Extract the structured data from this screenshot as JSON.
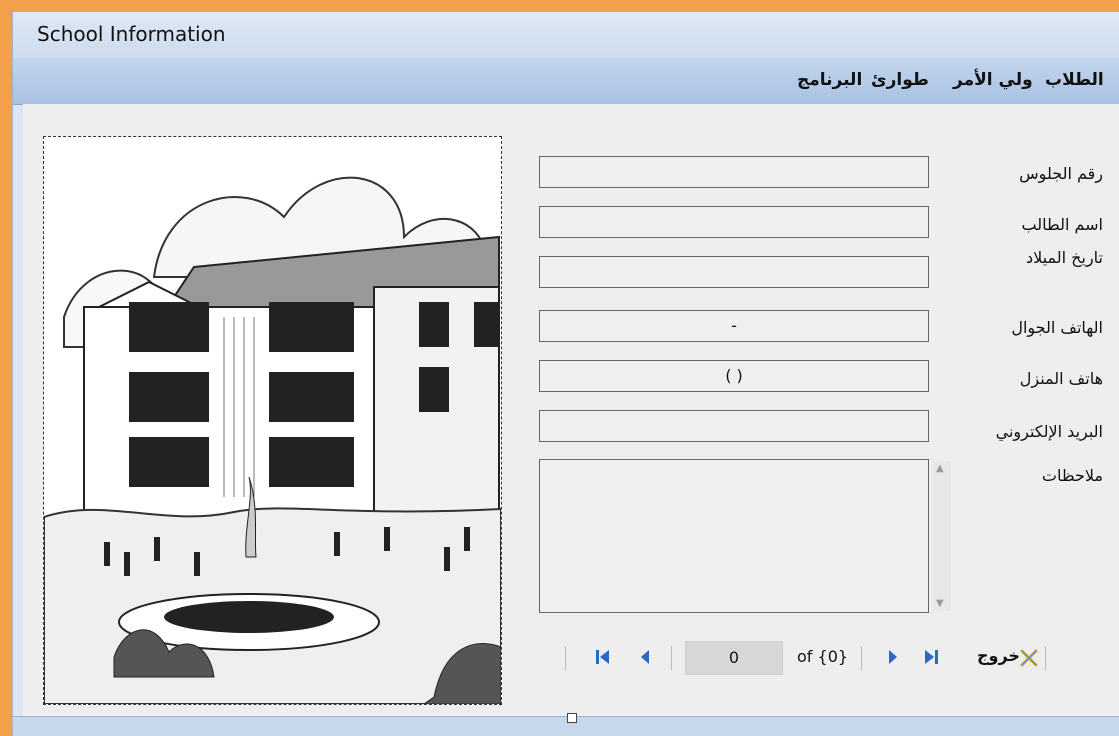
{
  "window": {
    "title": "School Information"
  },
  "menu": {
    "items": [
      {
        "label": "الطلاب"
      },
      {
        "label": "ولي الأمر"
      },
      {
        "label": "طوارئ"
      },
      {
        "label": "البرنامج"
      }
    ]
  },
  "form": {
    "fields": [
      {
        "label": "رقم الجلوس",
        "value": ""
      },
      {
        "label": "اسم الطالب",
        "value": ""
      },
      {
        "label": "تاريخ الميلاد",
        "value": ""
      },
      {
        "label": "الهاتف الجوال",
        "value": "-"
      },
      {
        "label": "هاتف المنزل",
        "value": "(   )"
      },
      {
        "label": "البريد الإلكتروني",
        "value": ""
      }
    ],
    "notes_label": "ملاحظات",
    "notes_value": ""
  },
  "navigator": {
    "position": "0",
    "of_text": "of {0}",
    "exit_label": "خروج"
  },
  "image": {
    "subject": "school-building-sketch"
  }
}
